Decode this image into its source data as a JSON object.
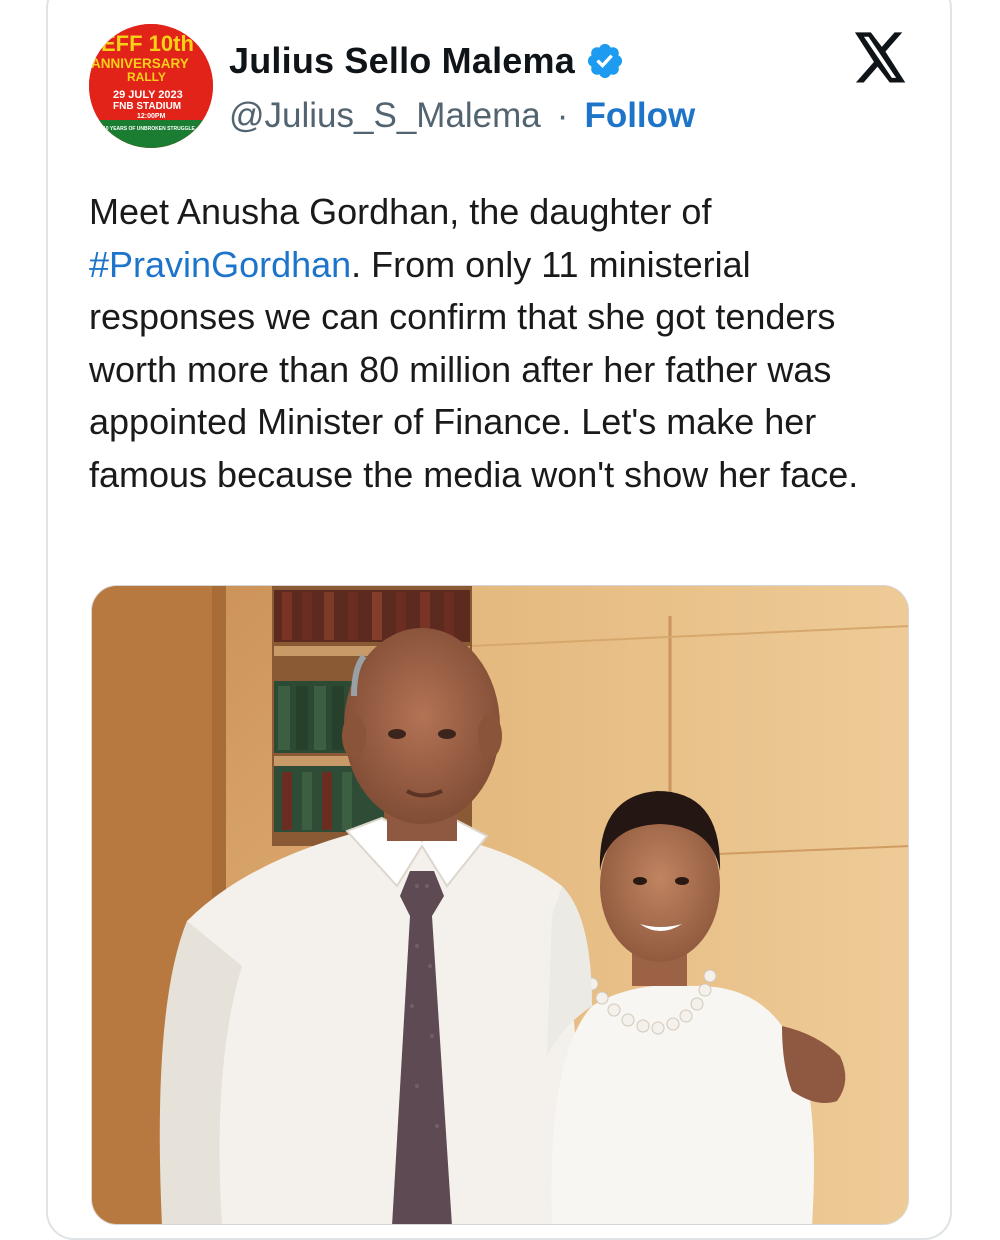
{
  "author": {
    "display_name": "Julius Sello Malema",
    "handle": "@Julius_S_Malema",
    "separator": "·",
    "follow_label": "Follow",
    "verified": true
  },
  "avatar_poster": {
    "line1": "EFF 10th",
    "line2": "ANNIVERSARY",
    "line3": "RALLY",
    "line4": "29 JULY 2023",
    "line5": "FNB STADIUM",
    "line6": "12:00PM",
    "line7": "10 YEARS OF UNBROKEN STRUGGLE"
  },
  "tweet": {
    "text_before": "Meet Anusha Gordhan, the daughter of ",
    "hashtag": "#PravinGordhan",
    "text_after": ". From only 11 ministerial responses we can confirm that she got tenders worth more than 80 million after her father was appointed Minister of Finance. Let's make her famous because the media won't show her face."
  },
  "icons": {
    "verified": "verified-badge-icon",
    "platform": "x-logo-icon"
  },
  "colors": {
    "link": "#1d74c9",
    "verified": "#1d9bf0",
    "secondary_text": "#536471",
    "poster_red": "#e2231a",
    "poster_yellow": "#f7d117"
  }
}
